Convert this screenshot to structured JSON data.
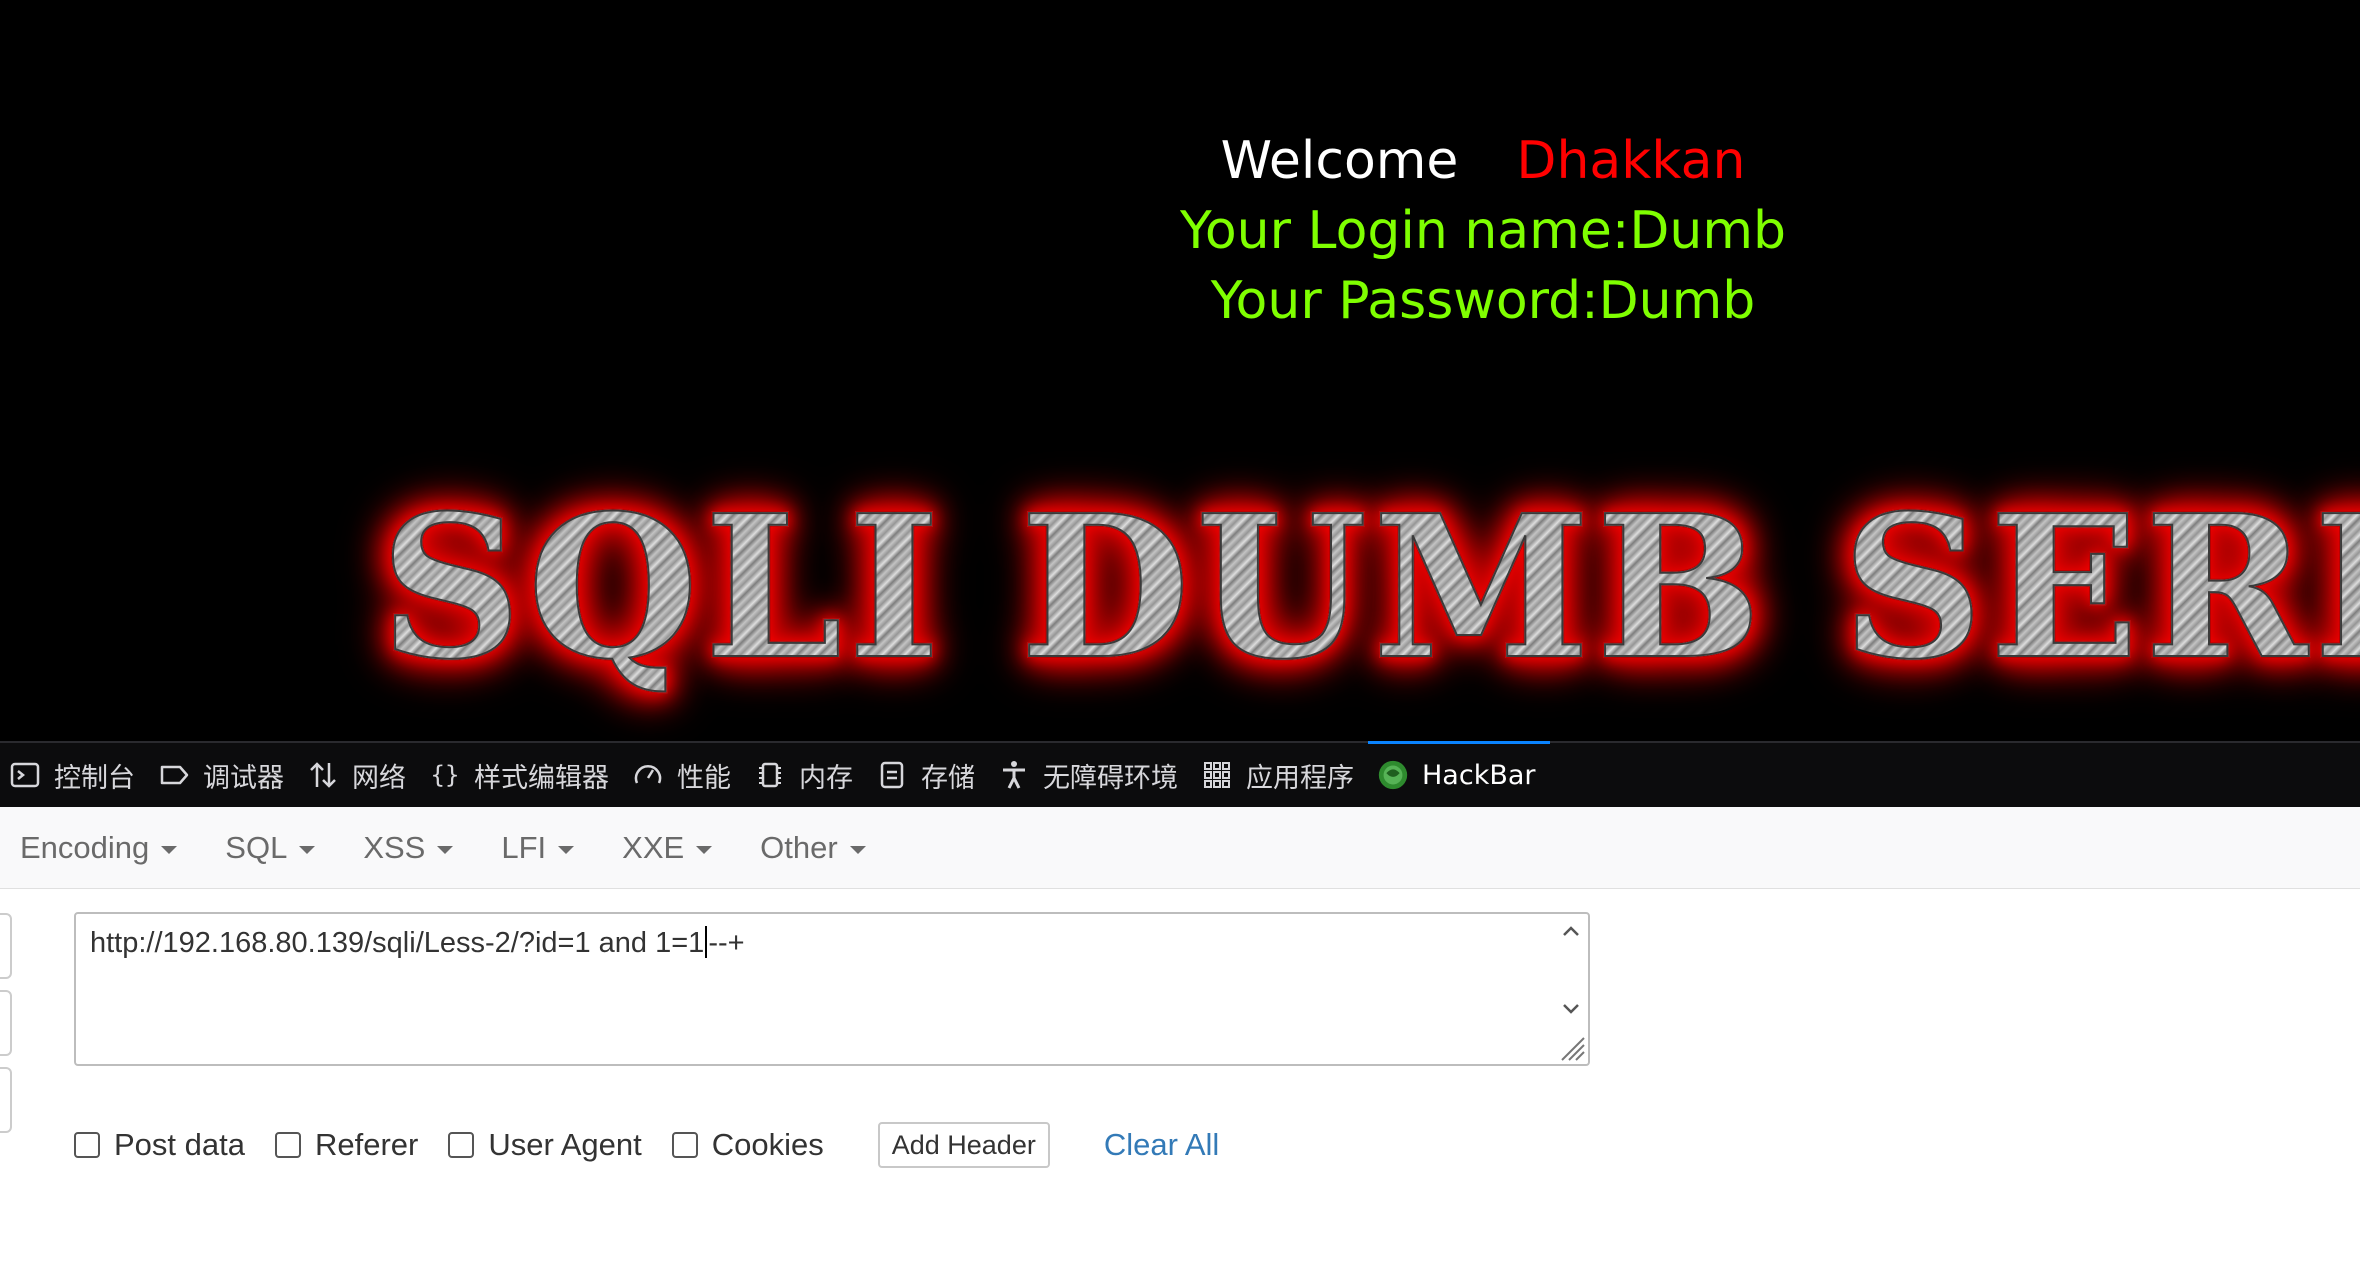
{
  "page": {
    "welcome_word": "Welcome",
    "welcome_name": "Dhakkan",
    "login_line": "Your Login name:Dumb",
    "password_line": "Your Password:Dumb",
    "banner_text": "SQLI DUMB SERIES"
  },
  "devtools": {
    "tabs": [
      {
        "label": "控制台",
        "icon": "console-icon"
      },
      {
        "label": "调试器",
        "icon": "debugger-icon"
      },
      {
        "label": "网络",
        "icon": "network-icon"
      },
      {
        "label": "样式编辑器",
        "icon": "style-editor-icon"
      },
      {
        "label": "性能",
        "icon": "performance-icon"
      },
      {
        "label": "内存",
        "icon": "memory-icon"
      },
      {
        "label": "存储",
        "icon": "storage-icon"
      },
      {
        "label": "无障碍环境",
        "icon": "accessibility-icon"
      },
      {
        "label": "应用程序",
        "icon": "application-icon"
      },
      {
        "label": "HackBar",
        "icon": "hackbar-icon",
        "active": true
      }
    ]
  },
  "hackbar": {
    "menu": [
      "Encoding",
      "SQL",
      "XSS",
      "LFI",
      "XXE",
      "Other"
    ],
    "url_before_caret": "http://192.168.80.139/sqli/Less-2/?id=1 and 1=1",
    "url_after_caret": "--+",
    "options": [
      "Post data",
      "Referer",
      "User Agent",
      "Cookies"
    ],
    "add_header_label": "Add Header",
    "clear_all_label": "Clear All"
  },
  "colors": {
    "viewport_bg": "#000000",
    "welcome_name": "#ff0000",
    "green_text": "#7fff00",
    "devtools_bg": "#0c0c0d",
    "active_tab_accent": "#0a84ff",
    "link": "#337ab7"
  }
}
